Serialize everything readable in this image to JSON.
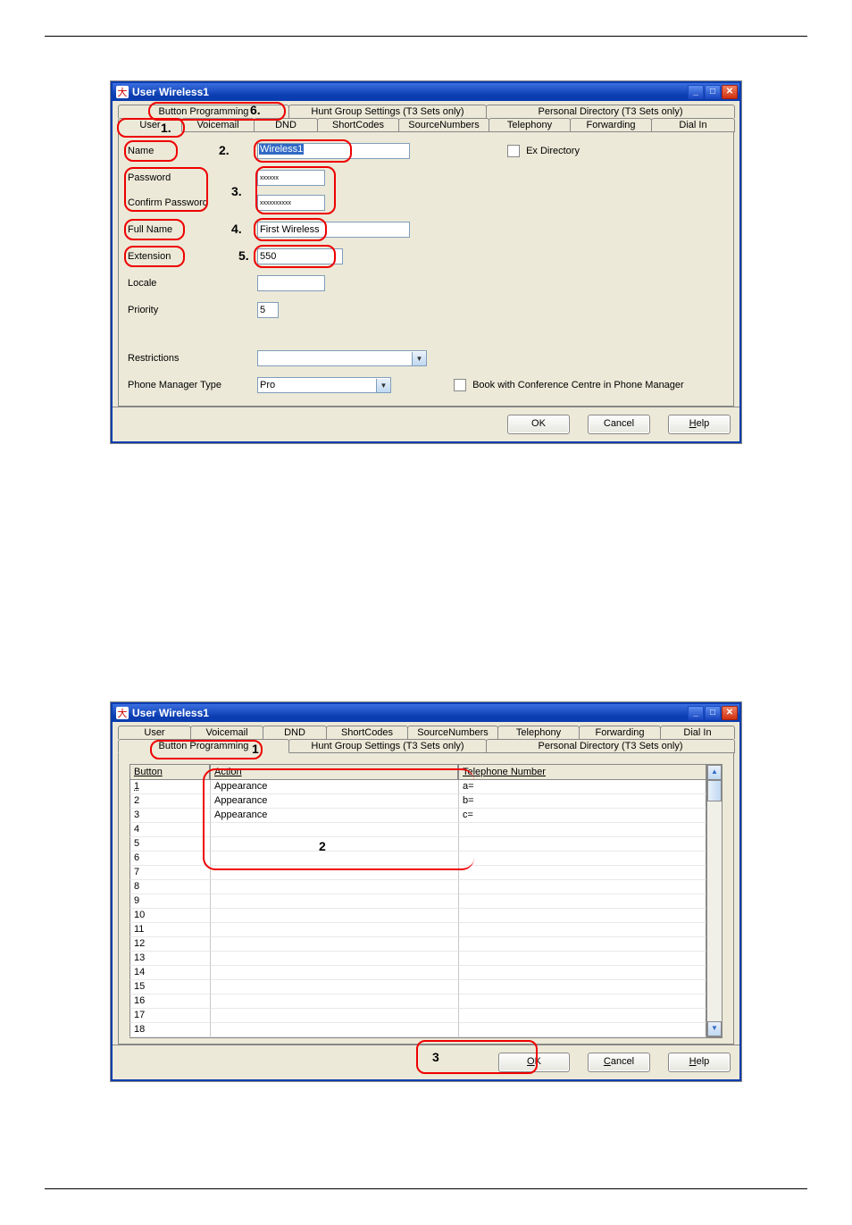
{
  "window1": {
    "title": "User Wireless1",
    "tabs_row1": [
      "Button Programming",
      "Hunt Group Settings (T3 Sets only)",
      "Personal Directory (T3 Sets only)"
    ],
    "tabs_row2": [
      "User",
      "Voicemail",
      "DND",
      "ShortCodes",
      "SourceNumbers",
      "Telephony",
      "Forwarding",
      "Dial In"
    ],
    "fields": {
      "name_label": "Name",
      "name_value": "Wireless1",
      "password_label": "Password",
      "password_value": "xxxxxx",
      "confirm_label": "Confirm Password",
      "confirm_value": "xxxxxxxxxx",
      "fullname_label": "Full Name",
      "fullname_value": "First Wireless",
      "extension_label": "Extension",
      "extension_value": "550",
      "locale_label": "Locale",
      "locale_value": "",
      "priority_label": "Priority",
      "priority_value": "5",
      "restrictions_label": "Restrictions",
      "restrictions_value": "",
      "pm_label": "Phone Manager Type",
      "pm_value": "Pro",
      "exdir_label": "Ex Directory",
      "book_label": "Book with Conference Centre in Phone Manager"
    },
    "buttons": {
      "ok": "OK",
      "cancel": "Cancel",
      "help": "Help"
    },
    "ann": {
      "n1": "1.",
      "n2": "2.",
      "n3": "3.",
      "n4": "4.",
      "n5": "5.",
      "n6": "6."
    }
  },
  "window2": {
    "title": "User Wireless1",
    "tabs_row1": [
      "User",
      "Voicemail",
      "DND",
      "ShortCodes",
      "SourceNumbers",
      "Telephony",
      "Forwarding",
      "Dial In"
    ],
    "tabs_row2": [
      "Button Programming",
      "Hunt Group Settings (T3 Sets only)",
      "Personal Directory (T3 Sets only)"
    ],
    "headers": {
      "button": "Button",
      "action": "Action",
      "tel": "Telephone Number"
    },
    "rows": [
      {
        "b": "1",
        "a": "Appearance",
        "t": "a="
      },
      {
        "b": "2",
        "a": "Appearance",
        "t": "b="
      },
      {
        "b": "3",
        "a": "Appearance",
        "t": "c="
      },
      {
        "b": "4",
        "a": "",
        "t": ""
      },
      {
        "b": "5",
        "a": "",
        "t": ""
      },
      {
        "b": "6",
        "a": "",
        "t": ""
      },
      {
        "b": "7",
        "a": "",
        "t": ""
      },
      {
        "b": "8",
        "a": "",
        "t": ""
      },
      {
        "b": "9",
        "a": "",
        "t": ""
      },
      {
        "b": "10",
        "a": "",
        "t": ""
      },
      {
        "b": "11",
        "a": "",
        "t": ""
      },
      {
        "b": "12",
        "a": "",
        "t": ""
      },
      {
        "b": "13",
        "a": "",
        "t": ""
      },
      {
        "b": "14",
        "a": "",
        "t": ""
      },
      {
        "b": "15",
        "a": "",
        "t": ""
      },
      {
        "b": "16",
        "a": "",
        "t": ""
      },
      {
        "b": "17",
        "a": "",
        "t": ""
      },
      {
        "b": "18",
        "a": "",
        "t": ""
      }
    ],
    "buttons": {
      "ok": "OK",
      "cancel": "Cancel",
      "help": "Help"
    },
    "ann": {
      "n1": "1",
      "n2": "2",
      "n3": "3"
    }
  }
}
